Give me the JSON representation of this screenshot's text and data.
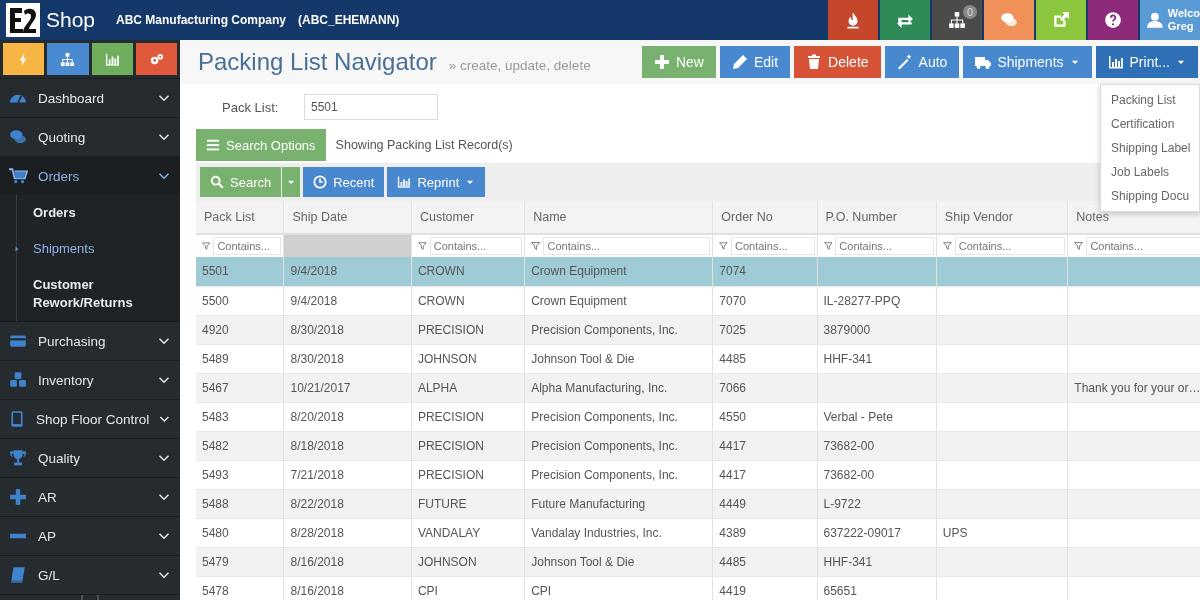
{
  "app": {
    "logo": "Shop",
    "company": "ABC Manufacturing Company",
    "user_code": "(ABC_EHEMANN)"
  },
  "header_tiles": [
    {
      "color": "#c4472c"
    },
    {
      "color": "#2e8b57"
    },
    {
      "color": "#4b4b4b",
      "badge": "0"
    },
    {
      "color": "#f0915a"
    },
    {
      "color": "#8cc63e"
    },
    {
      "color": "#8e2a7a"
    }
  ],
  "user": {
    "greeting": "Welco",
    "name": "Greg"
  },
  "sidebar": {
    "tiles": [
      {
        "color": "#f6b545"
      },
      {
        "color": "#4a8ad0"
      },
      {
        "color": "#6fae5c"
      },
      {
        "color": "#e0593a"
      }
    ],
    "items": [
      {
        "label": "Dashboard",
        "selected": false
      },
      {
        "label": "Quoting",
        "selected": false
      },
      {
        "label": "Orders",
        "selected": true,
        "children": [
          {
            "label": "Orders",
            "selected": false
          },
          {
            "label": "Shipments",
            "selected": true
          },
          {
            "label": "Customer Rework/Returns",
            "selected": false
          }
        ]
      },
      {
        "label": "Purchasing",
        "selected": false
      },
      {
        "label": "Inventory",
        "selected": false
      },
      {
        "label": "Shop Floor Control",
        "selected": false
      },
      {
        "label": "Quality",
        "selected": false
      },
      {
        "label": "AR",
        "selected": false
      },
      {
        "label": "AP",
        "selected": false
      },
      {
        "label": "G/L",
        "selected": false
      }
    ]
  },
  "page": {
    "title": "Packing List Navigator",
    "subtitle": "» create, update, delete"
  },
  "actions": [
    {
      "label": "New",
      "kind": "success"
    },
    {
      "label": "Edit",
      "kind": "primary"
    },
    {
      "label": "Delete",
      "kind": "danger"
    },
    {
      "label": "Auto",
      "kind": "primary"
    },
    {
      "label": "Shipments",
      "kind": "primary",
      "dropdown": true
    },
    {
      "label": "Print...",
      "kind": "dark",
      "dropdown": true,
      "open": true
    }
  ],
  "print_menu": [
    "Packing List",
    "Certification",
    "Shipping Label",
    "Job Labels",
    "Shipping Docu"
  ],
  "filter": {
    "label": "Pack List:",
    "value": "5501"
  },
  "search_options": {
    "label": "Search Options",
    "status": "Showing Packing List Record(s)"
  },
  "toolbar": [
    {
      "label": "Search",
      "kind": "success",
      "split": true
    },
    {
      "label": "Recent",
      "kind": "primary"
    },
    {
      "label": "Reprint",
      "kind": "primary",
      "dropdown": true
    }
  ],
  "table": {
    "columns": [
      {
        "label": "Pack List",
        "placeholder": "Contains..."
      },
      {
        "label": "Ship Date"
      },
      {
        "label": "Customer",
        "placeholder": "Contains..."
      },
      {
        "label": "Name",
        "placeholder": "Contains..."
      },
      {
        "label": "Order No",
        "placeholder": "Contains..."
      },
      {
        "label": "P.O. Number",
        "placeholder": "Contains..."
      },
      {
        "label": "Ship Vendor",
        "placeholder": "Contains..."
      },
      {
        "label": "Notes",
        "placeholder": "Contains..."
      }
    ],
    "rows": [
      {
        "selected": true,
        "cells": [
          "5501",
          "9/4/2018",
          "CROWN",
          "Crown Equipment",
          "7074",
          "",
          "",
          ""
        ]
      },
      {
        "selected": false,
        "cells": [
          "5500",
          "9/4/2018",
          "CROWN",
          "Crown Equipment",
          "7070",
          "IL-28277-PPQ",
          "",
          ""
        ]
      },
      {
        "selected": false,
        "cells": [
          "4920",
          "8/30/2018",
          "PRECISION",
          "Precision Components, Inc.",
          "7025",
          "3879000",
          "",
          ""
        ]
      },
      {
        "selected": false,
        "cells": [
          "5489",
          "8/30/2018",
          "JOHNSON",
          "Johnson Tool & Die",
          "4485",
          "HHF-341",
          "",
          ""
        ]
      },
      {
        "selected": false,
        "cells": [
          "5467",
          "10/21/2017",
          "ALPHA",
          "Alpha Manufacturing, Inc.",
          "7066",
          "",
          "",
          "Thank you for your or…"
        ]
      },
      {
        "selected": false,
        "cells": [
          "5483",
          "8/20/2018",
          "PRECISION",
          "Precision Components, Inc.",
          "4550",
          "Verbal - Pete",
          "",
          ""
        ]
      },
      {
        "selected": false,
        "cells": [
          "5482",
          "8/18/2018",
          "PRECISION",
          "Precision Components, Inc.",
          "4417",
          "73682-00",
          "",
          ""
        ]
      },
      {
        "selected": false,
        "cells": [
          "5493",
          "7/21/2018",
          "PRECISION",
          "Precision Components, Inc.",
          "4417",
          "73682-00",
          "",
          ""
        ]
      },
      {
        "selected": false,
        "cells": [
          "5488",
          "8/22/2018",
          "FUTURE",
          "Future Manufacturing",
          "4449",
          "L-9722",
          "",
          ""
        ]
      },
      {
        "selected": false,
        "cells": [
          "5480",
          "8/28/2018",
          "VANDALAY",
          "Vandalay Industries, Inc.",
          "4389",
          "637222-09017",
          "UPS",
          ""
        ]
      },
      {
        "selected": false,
        "cells": [
          "5479",
          "8/16/2018",
          "JOHNSON",
          "Johnson Tool & Die",
          "4485",
          "HHF-341",
          "",
          ""
        ]
      },
      {
        "selected": false,
        "cells": [
          "5478",
          "8/16/2018",
          "CPI",
          "CPI",
          "4419",
          "65651",
          "",
          ""
        ]
      }
    ]
  }
}
